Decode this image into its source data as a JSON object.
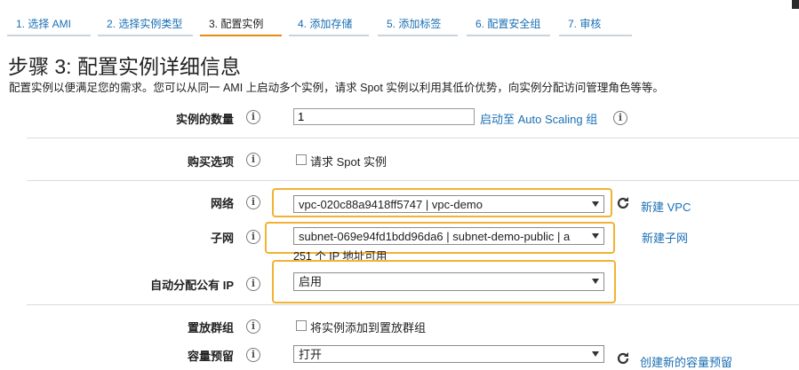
{
  "wizard": {
    "steps": [
      {
        "label": "1. 选择 AMI"
      },
      {
        "label": "2. 选择实例类型"
      },
      {
        "label": "3. 配置实例"
      },
      {
        "label": "4. 添加存储"
      },
      {
        "label": "5. 添加标签"
      },
      {
        "label": "6. 配置安全组"
      },
      {
        "label": "7. 审核"
      }
    ],
    "active_index": 2
  },
  "page": {
    "title": "步骤 3: 配置实例详细信息",
    "description": "配置实例以便满足您的需求。您可以从同一 AMI 上启动多个实例，请求 Spot 实例以利用其低价优势，向实例分配访问管理角色等等。"
  },
  "form": {
    "instance_count": {
      "label": "实例的数量",
      "value": "1",
      "link": "启动至 Auto Scaling 组"
    },
    "purchase_option": {
      "label": "购买选项",
      "checkbox_label": "请求 Spot 实例"
    },
    "network": {
      "label": "网络",
      "value": "vpc-020c88a9418ff5747 | vpc-demo",
      "link": "新建 VPC"
    },
    "subnet": {
      "label": "子网",
      "value": "subnet-069e94fd1bdd96da6 | subnet-demo-public | a",
      "link": "新建子网",
      "note": "251 个 IP 地址可用"
    },
    "auto_ip": {
      "label": "自动分配公有 IP",
      "value": "启用"
    },
    "placement": {
      "label": "置放群组",
      "checkbox_label": "将实例添加到置放群组"
    },
    "capacity": {
      "label": "容量预留",
      "value": "打开",
      "link": "创建新的容量预留"
    }
  },
  "info_glyph": "i",
  "colors": {
    "link": "#1a6fb3",
    "highlight": "#f2b233",
    "active_tab": "#e88a12"
  }
}
